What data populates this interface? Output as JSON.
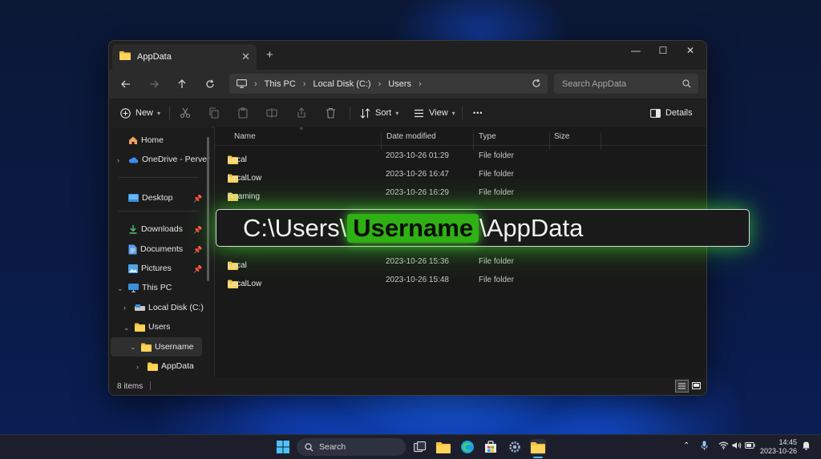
{
  "window": {
    "tab_title": "AppData",
    "minimize_glyph": "—",
    "maximize_glyph": "☐",
    "close_glyph": "✕",
    "new_tab_glyph": "+",
    "tab_close_glyph": "✕"
  },
  "address": {
    "crumbs": [
      "This PC",
      "Local Disk (C:)",
      "Users"
    ]
  },
  "search": {
    "placeholder": "Search AppData"
  },
  "toolbar": {
    "new_label": "New",
    "sort_label": "Sort",
    "view_label": "View",
    "details_label": "Details",
    "more_glyph": "•••"
  },
  "sidebar": {
    "home": "Home",
    "onedrive": "OneDrive - Perver",
    "desktop": "Desktop",
    "downloads": "Downloads",
    "documents": "Documents",
    "pictures": "Pictures",
    "this_pc": "This PC",
    "local_disk": "Local Disk (C:)",
    "users": "Users",
    "username": "Username",
    "appdata": "AppData"
  },
  "columns": {
    "name": "Name",
    "date": "Date modified",
    "type": "Type",
    "size": "Size"
  },
  "rows": [
    {
      "name": "Local",
      "date": "2023-10-26 01:29",
      "type": "File folder"
    },
    {
      "name": "LocalLow",
      "date": "2023-10-26 16:47",
      "type": "File folder"
    },
    {
      "name": "Roaming",
      "date": "2023-10-26 16:29",
      "type": "File folder"
    },
    {
      "name": "Local",
      "date": "2023-10-26 15:36",
      "type": "File folder"
    },
    {
      "name": "LocalLow",
      "date": "2023-10-26 15:48",
      "type": "File folder"
    }
  ],
  "status": {
    "items": "8 items"
  },
  "overlay": {
    "prefix": "C:\\Users\\",
    "highlight": "Username",
    "suffix": "\\AppData"
  },
  "taskbar": {
    "search_label": "Search",
    "time": "14:45",
    "date": "2023-10-26"
  },
  "colors": {
    "accent_green": "#2fb014",
    "folder_yellow": "#f3c13a",
    "window_bg": "#1c1c1c"
  }
}
